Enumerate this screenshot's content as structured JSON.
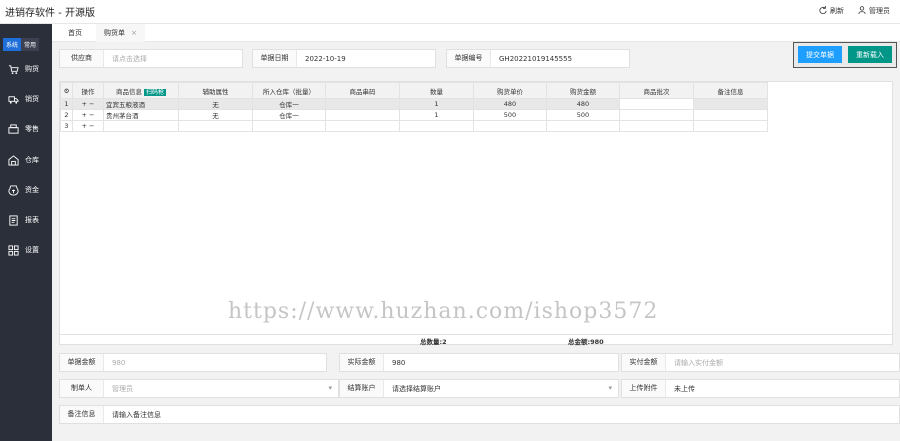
{
  "app": {
    "title": "进销存软件 - 开源版"
  },
  "top_actions": {
    "refresh": "刷新",
    "user": "管理员"
  },
  "sidebar": {
    "tabs": [
      "系统",
      "常用"
    ],
    "items": [
      {
        "label": "购货",
        "icon": "cart-icon"
      },
      {
        "label": "销货",
        "icon": "truck-icon"
      },
      {
        "label": "零售",
        "icon": "register-icon"
      },
      {
        "label": "仓库",
        "icon": "warehouse-icon"
      },
      {
        "label": "资金",
        "icon": "money-icon"
      },
      {
        "label": "报表",
        "icon": "report-icon"
      },
      {
        "label": "设置",
        "icon": "grid-icon"
      }
    ]
  },
  "tabs": [
    {
      "label": "首页"
    },
    {
      "label": "购货单"
    }
  ],
  "form": {
    "supplier": {
      "label": "供应商",
      "placeholder": "请点击选择"
    },
    "date": {
      "label": "单据日期",
      "value": "2022-10-19"
    },
    "number": {
      "label": "单据编号",
      "value": "GH20221019145555"
    }
  },
  "buttons": {
    "submit": "提交单据",
    "reload": "重新载入"
  },
  "table": {
    "headers": {
      "settings": "⚙",
      "op": "操作",
      "product": "商品信息",
      "scan": "扫码枪",
      "attr": "辅助属性",
      "warehouse": "所入仓库（批量）",
      "serial": "商品串码",
      "qty": "数量",
      "price": "购货单价",
      "amount": "购货金额",
      "batch": "商品批次",
      "remark": "备注信息"
    },
    "rows": [
      {
        "no": "1",
        "op": "+ −",
        "product": "宜宾五粮液酒",
        "attr": "无",
        "warehouse": "仓库一",
        "serial": "",
        "qty": "1",
        "price": "480",
        "amount": "480",
        "batch": "",
        "remark": ""
      },
      {
        "no": "2",
        "op": "+ −",
        "product": "贵州茅台酒",
        "attr": "无",
        "warehouse": "仓库一",
        "serial": "",
        "qty": "1",
        "price": "500",
        "amount": "500",
        "batch": "",
        "remark": ""
      },
      {
        "no": "3",
        "op": "+ −",
        "product": "",
        "attr": "",
        "warehouse": "",
        "serial": "",
        "qty": "",
        "price": "",
        "amount": "",
        "batch": "",
        "remark": ""
      }
    ],
    "footer": {
      "total_qty": "总数量:2",
      "total_amount": "总金额:980"
    }
  },
  "bottom": {
    "bill_amount": {
      "label": "单据金额",
      "value": "980"
    },
    "actual_amount": {
      "label": "实际金额",
      "value": "980"
    },
    "paid_amount": {
      "label": "实付金额",
      "placeholder": "请输入实付金额"
    },
    "maker": {
      "label": "制单人",
      "value": "管理员"
    },
    "account": {
      "label": "结算账户",
      "placeholder": "请选择结算账户"
    },
    "attachment": {
      "label": "上传附件",
      "value": "未上传"
    },
    "remark": {
      "label": "备注信息",
      "placeholder": "请输入备注信息"
    }
  },
  "watermark": "https://www.huzhan.com/ishop3572",
  "colors": {
    "sidebar": "#2b2f3a",
    "accent_blue": "#1e9fff",
    "accent_teal": "#009688"
  }
}
